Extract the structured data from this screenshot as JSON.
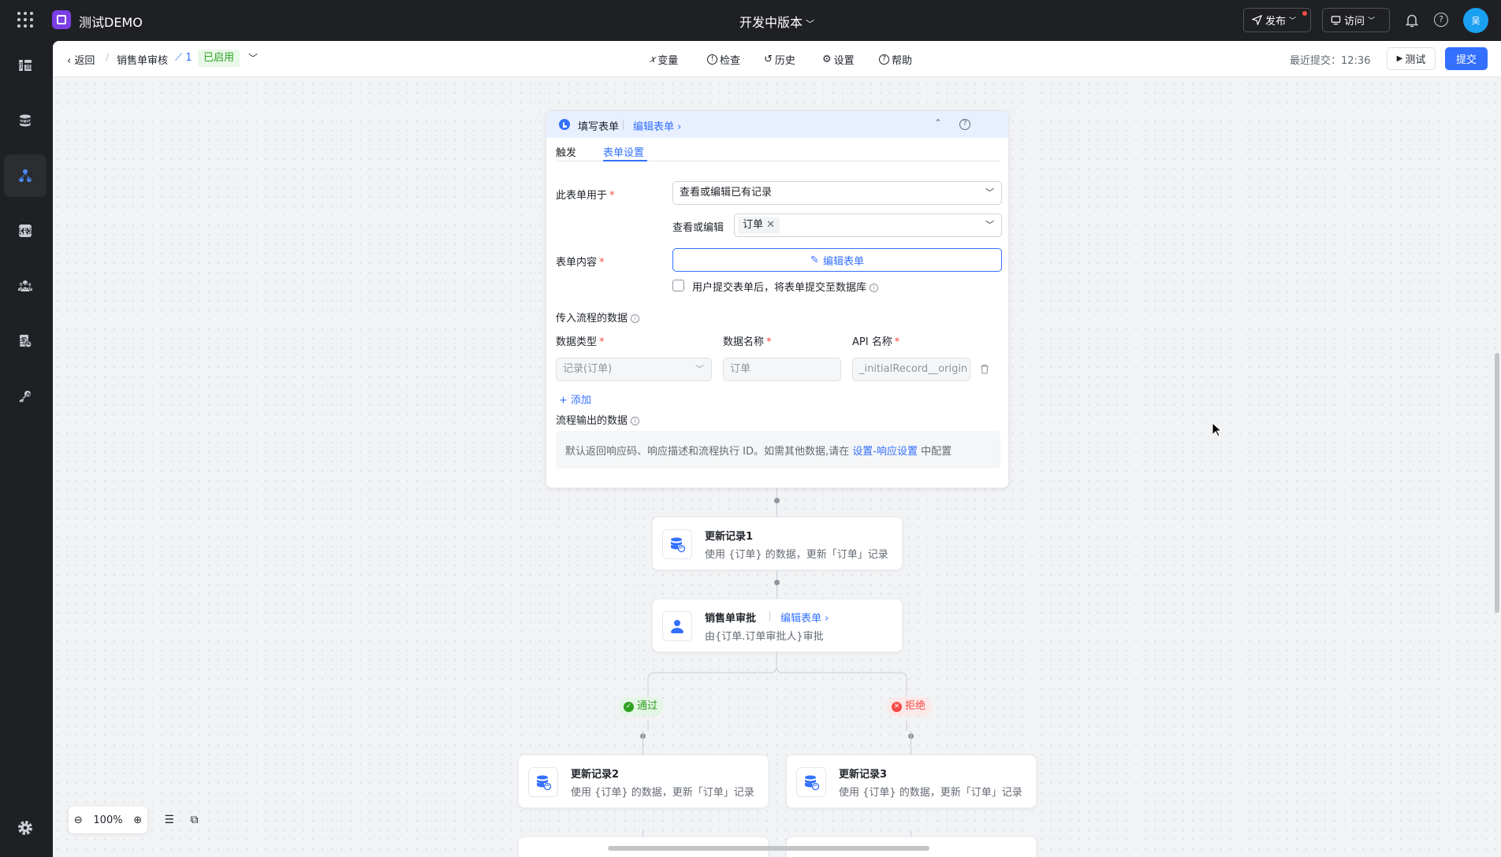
{
  "app": {
    "name": "测试DEMO",
    "version": "开发中版本"
  },
  "topbar": {
    "publish": "发布",
    "visit": "访问",
    "avatar_text": "吴"
  },
  "sidebar": {
    "items": [
      {
        "label": "页面",
        "icon": "pages-icon"
      },
      {
        "label": "数据",
        "icon": "database-icon"
      },
      {
        "label": "流程",
        "icon": "flow-icon",
        "active": true
      },
      {
        "label": "低代码",
        "icon": "code-icon"
      },
      {
        "label": "权限",
        "icon": "users-icon"
      },
      {
        "label": "日志",
        "icon": "log-icon"
      },
      {
        "label": "集成",
        "icon": "key-icon"
      }
    ]
  },
  "subbar": {
    "back": "返回",
    "flow_name": "销售单审核",
    "flow_version": "1",
    "status": "已启用",
    "tools": [
      "变量",
      "检查",
      "历史",
      "设置",
      "帮助"
    ],
    "last_submit": "最近提交：12:36",
    "test": "测试",
    "submit": "提交"
  },
  "form_card": {
    "title": "填写表单",
    "edit_link": "编辑表单",
    "tabs": [
      "触发",
      "表单设置"
    ],
    "active_tab": 1,
    "usage_label": "此表单用于",
    "usage_value": "查看或编辑已有记录",
    "view_edit_label": "查看或编辑",
    "view_edit_chip": "订单",
    "content_label": "表单内容",
    "edit_form_btn": "编辑表单",
    "checkbox_label": "用户提交表单后，将表单提交至数据库",
    "input_section": "传入流程的数据",
    "col_type": "数据类型",
    "col_name": "数据名称",
    "col_api": "API 名称",
    "row_type": "记录(订单)",
    "row_name": "订单",
    "row_api": "_initialRecord__origin",
    "add": "添加",
    "output_section": "流程输出的数据",
    "note_prefix": "默认返回响应码、响应描述和流程执行 ID。如需其他数据,请在 ",
    "note_link": "设置-响应设置",
    "note_suffix": " 中配置"
  },
  "nodes": {
    "update1": {
      "title": "更新记录1",
      "desc": "使用 {订单} 的数据，更新「订单」记录"
    },
    "approval": {
      "title": "销售单审批",
      "link": "编辑表单",
      "desc": "由{订单.订单审批人}审批"
    },
    "pass": "通过",
    "reject": "拒绝",
    "update2": {
      "title": "更新记录2",
      "desc": "使用 {订单} 的数据，更新「订单」记录"
    },
    "update3": {
      "title": "更新记录3",
      "desc": "使用 {订单} 的数据，更新「订单」记录"
    }
  },
  "zoom": {
    "level": "100%"
  },
  "colors": {
    "accent": "#3370ff",
    "success": "#2ea121",
    "danger": "#f54a45",
    "brand": "#7b3fe4"
  }
}
